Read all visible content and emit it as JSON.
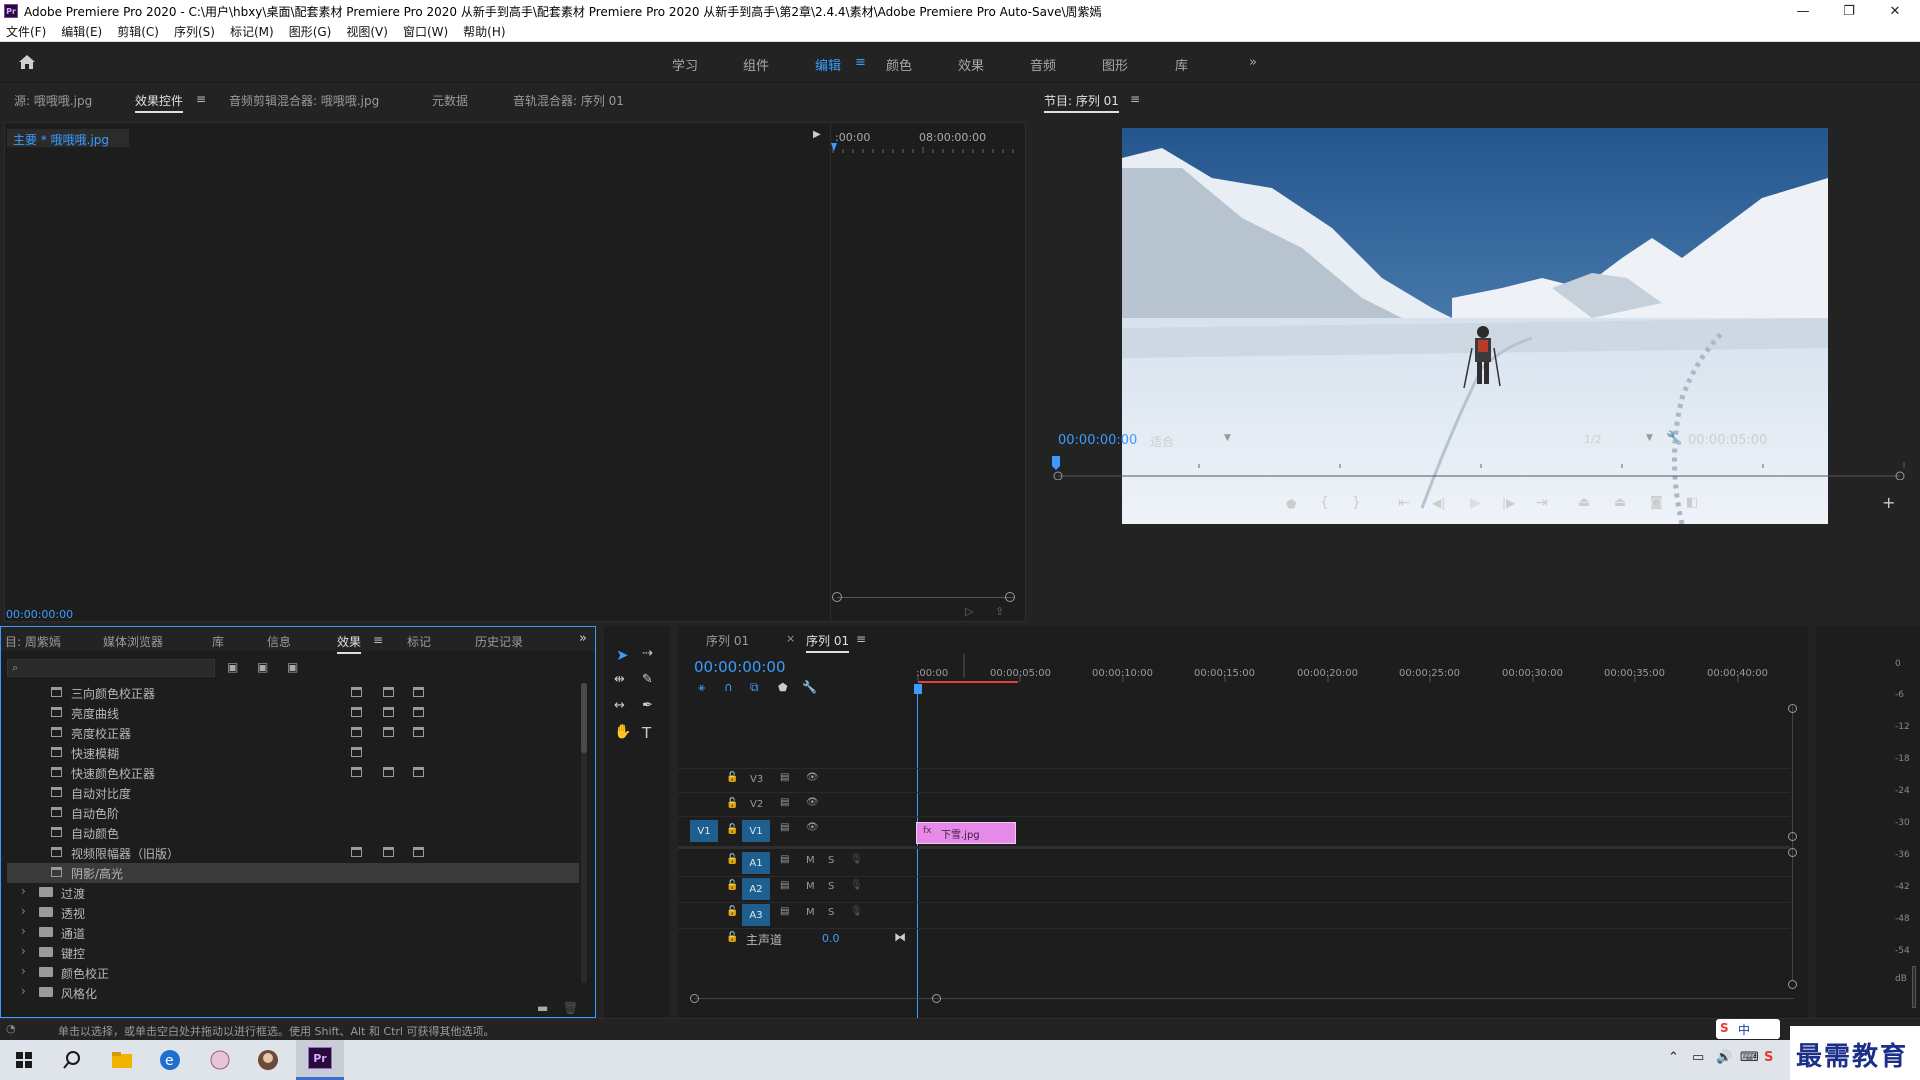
{
  "titlebar": {
    "title": "Adobe Premiere Pro 2020 - C:\\用户\\hbxy\\桌面\\配套素材 Premiere Pro 2020 从新手到高手\\配套素材 Premiere Pro 2020 从新手到高手\\第2章\\2.4.4\\素材\\Adobe Premiere Pro Auto-Save\\周紫嫣",
    "minimize": "—",
    "restore": "❐",
    "close": "✕"
  },
  "menu": [
    "文件(F)",
    "编辑(E)",
    "剪辑(C)",
    "序列(S)",
    "标记(M)",
    "图形(G)",
    "视图(V)",
    "窗口(W)",
    "帮助(H)"
  ],
  "workspaces": {
    "items": [
      "学习",
      "组件",
      "编辑",
      "颜色",
      "效果",
      "音频",
      "图形",
      "库"
    ],
    "active": "编辑",
    "more": "»"
  },
  "source_panel": {
    "tabs": [
      "源: 哦哦哦.jpg",
      "效果控件",
      "音频剪辑混合器: 哦哦哦.jpg",
      "元数据",
      "音轨混合器: 序列 01"
    ],
    "active_tab": "效果控件",
    "clip_label": "主要 * 哦哦哦.jpg",
    "ruler_start": ":00:00",
    "ruler_end": "08:00:00:00",
    "timecode": "00:00:00:00"
  },
  "program_monitor": {
    "title": "节目: 序列 01",
    "timecode_current": "00:00:00:00",
    "zoom": "适合",
    "resolution": "1/2",
    "timecode_duration": "00:00:05:00"
  },
  "project_panel": {
    "tabs": [
      "目: 周紫嫣",
      "媒体浏览器",
      "库",
      "信息",
      "效果",
      "标记",
      "历史记录"
    ],
    "active_tab": "效果",
    "search_placeholder": "",
    "effects": [
      {
        "label": "三向颜色校正器",
        "badges": 3
      },
      {
        "label": "亮度曲线",
        "badges": 3
      },
      {
        "label": "亮度校正器",
        "badges": 3
      },
      {
        "label": "快速模糊",
        "badges": 1
      },
      {
        "label": "快速颜色校正器",
        "badges": 3
      },
      {
        "label": "自动对比度",
        "badges": 0
      },
      {
        "label": "自动色阶",
        "badges": 0
      },
      {
        "label": "自动颜色",
        "badges": 0
      },
      {
        "label": "视频限幅器（旧版）",
        "badges": 3
      },
      {
        "label": "阴影/高光",
        "badges": 0
      }
    ],
    "folders": [
      "过渡",
      "透视",
      "通道",
      "键控",
      "颜色校正",
      "风格化"
    ]
  },
  "timeline": {
    "tabs": [
      "序列 01",
      "序列 01"
    ],
    "active_tab_index": 1,
    "timecode": "00:00:00:00",
    "ruler": [
      ":00:00",
      "00:00:05:00",
      "00:00:10:00",
      "00:00:15:00",
      "00:00:20:00",
      "00:00:25:00",
      "00:00:30:00",
      "00:00:35:00",
      "00:00:40:00"
    ],
    "video_tracks": [
      "V3",
      "V2",
      "V1"
    ],
    "audio_tracks": [
      "A1",
      "A2",
      "A3"
    ],
    "source_patch_v": "V1",
    "clip_name": "下雪.jpg",
    "master_label": "主声道",
    "master_value": "0.0",
    "mute": "M",
    "solo": "S"
  },
  "audio_meter": {
    "labels": [
      "0",
      "-6",
      "-12",
      "-18",
      "-24",
      "-30",
      "-36",
      "-42",
      "-48",
      "-54",
      "dB"
    ]
  },
  "statusbar": {
    "text": "单击以选择，或单击空白处并拖动以进行框选。使用 Shift、Alt 和 Ctrl 可获得其他选项。"
  },
  "watermark": {
    "text": "最需教育"
  },
  "ime": {
    "label": "中"
  }
}
